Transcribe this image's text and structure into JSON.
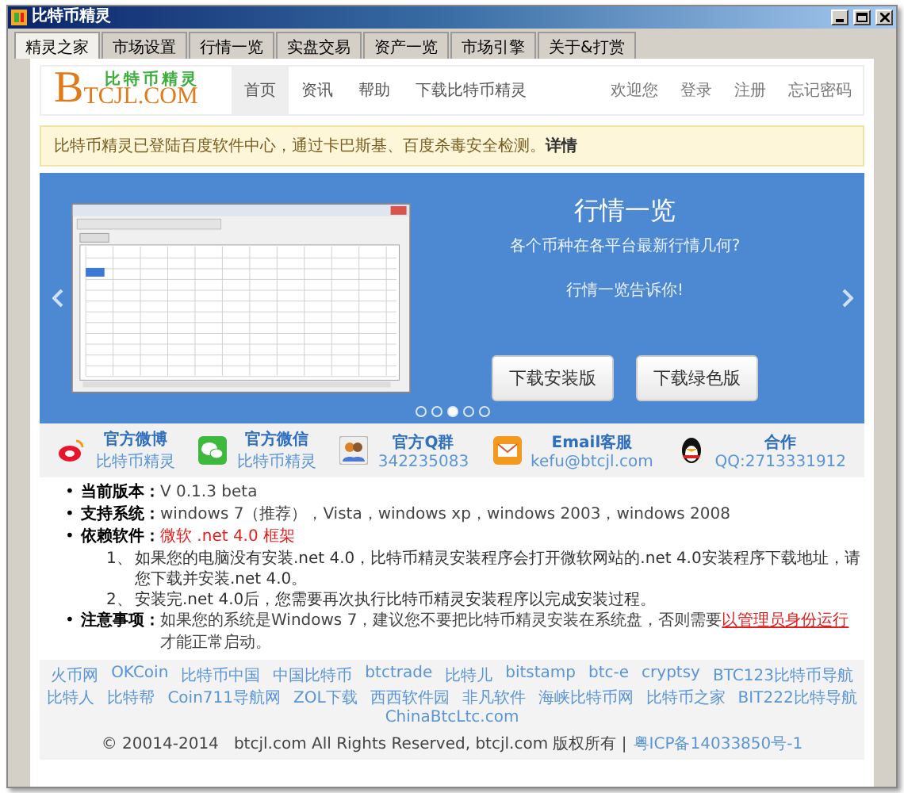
{
  "window": {
    "title": "比特币精灵"
  },
  "tabs": [
    {
      "label": "精灵之家",
      "selected": true
    },
    {
      "label": "市场设置",
      "selected": false
    },
    {
      "label": "行情一览",
      "selected": false
    },
    {
      "label": "实盘交易",
      "selected": false
    },
    {
      "label": "资产一览",
      "selected": false
    },
    {
      "label": "市场引擎",
      "selected": false
    },
    {
      "label": "关于&打赏",
      "selected": false
    }
  ],
  "header": {
    "logo": {
      "mark": "B",
      "name": "TCJL.COM",
      "tagline": "比特币精灵"
    },
    "nav": [
      {
        "label": "首页",
        "selected": true
      },
      {
        "label": "资讯",
        "selected": false
      },
      {
        "label": "帮助",
        "selected": false
      },
      {
        "label": "下载比特币精灵",
        "selected": false
      }
    ],
    "user_links": [
      "欢迎您",
      "登录",
      "注册",
      "忘记密码"
    ]
  },
  "notice": {
    "text": "比特币精灵已登陆百度软件中心，通过卡巴斯基、百度杀毒安全检测。",
    "link": "详情"
  },
  "slide": {
    "title": "行情一览",
    "subtitle": "各个币种在各平台最新行情几何?",
    "line": "行情一览告诉你!",
    "buttons": [
      "下载安装版",
      "下载绿色版"
    ],
    "dots": [
      {
        "selected": false
      },
      {
        "selected": false
      },
      {
        "selected": true
      },
      {
        "selected": false
      },
      {
        "selected": false
      }
    ]
  },
  "contacts": [
    {
      "kind": "weibo",
      "title": "官方微博",
      "value": "比特币精灵"
    },
    {
      "kind": "wechat",
      "title": "官方微信",
      "value": "比特币精灵"
    },
    {
      "kind": "group",
      "title": "官方Q群",
      "value": "342235083"
    },
    {
      "kind": "email",
      "title": "Email客服",
      "value": "kefu@btcjl.com"
    },
    {
      "kind": "qq",
      "title": "合作",
      "value": "QQ:2713331912"
    }
  ],
  "info": [
    {
      "marker": "•",
      "label": "当前版本：",
      "value": "V 0.1.3 beta",
      "highlighted": false
    },
    {
      "marker": "•",
      "label": "支持系统：",
      "value": "windows 7（推荐），Vista，windows xp，windows 2003，windows 2008",
      "highlighted": false
    },
    {
      "marker": "•",
      "label": "依赖软件：",
      "value": "微软 .net 4.0 框架",
      "highlighted": true,
      "steps": [
        {
          "marker": "1、",
          "text": "如果您的电脑没有安装.net 4.0，比特币精灵安装程序会打开微软网站的.net 4.0安装程序下载地址，请您下载并安装.net 4.0。"
        },
        {
          "marker": "2、",
          "text": "安装完.net 4.0后，您需要再次执行比特币精灵安装程序以完成安装过程。"
        }
      ]
    },
    {
      "marker": "•",
      "label": "注意事项：",
      "value": "如果您的系统是Windows 7，建议您不要把比特币精灵安装在系统盘，否则需要",
      "link": "以管理员身份运行",
      "value_after": "才能正常启动。",
      "highlighted": false
    }
  ],
  "footer": {
    "links": [
      "火币网",
      "OKCoin",
      "比特币中国",
      "中国比特币",
      "btctrade",
      "比特儿",
      "bitstamp",
      "btc-e",
      "cryptsy",
      "BTC123比特币导航",
      "比特人",
      "比特帮",
      "Coin711导航网",
      "ZOL下载",
      "西西软件园",
      "非凡软件",
      "海峡比特币网",
      "比特币之家",
      "BIT222比特导航",
      "ChinaBtcLtc.com"
    ],
    "copyright": "© 20014-2014   btcjl.com All Rights Reserved, btcjl.com 版权所有 |",
    "icp": "粤ICP备14033850号-1"
  }
}
